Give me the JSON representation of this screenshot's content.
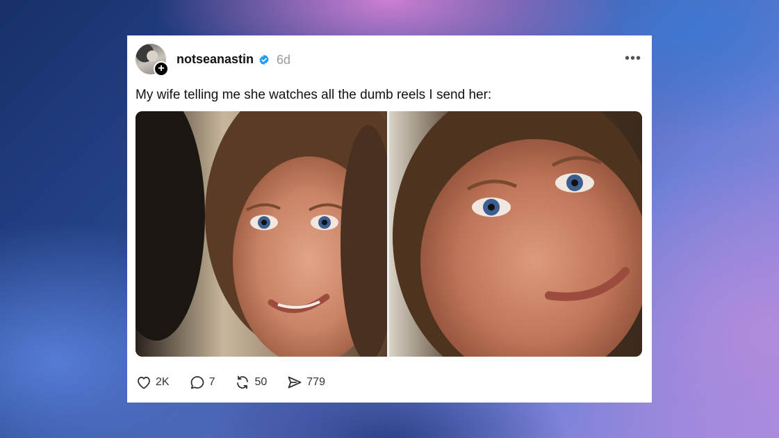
{
  "post": {
    "username": "notseanastin",
    "verified_icon": "verified-badge-icon",
    "verified_color": "#1d9bf0",
    "time": "6d",
    "more_label": "•••",
    "follow_label": "+",
    "caption": "My wife telling me she watches all the dumb reels I send her:",
    "media": {
      "panels": 2,
      "description_icon": "meme-photo"
    },
    "actions": {
      "like": {
        "icon": "heart-icon",
        "count": "2K"
      },
      "reply": {
        "icon": "comment-icon",
        "count": "7"
      },
      "repost": {
        "icon": "repost-icon",
        "count": "50"
      },
      "share": {
        "icon": "share-icon",
        "count": "779"
      }
    }
  }
}
